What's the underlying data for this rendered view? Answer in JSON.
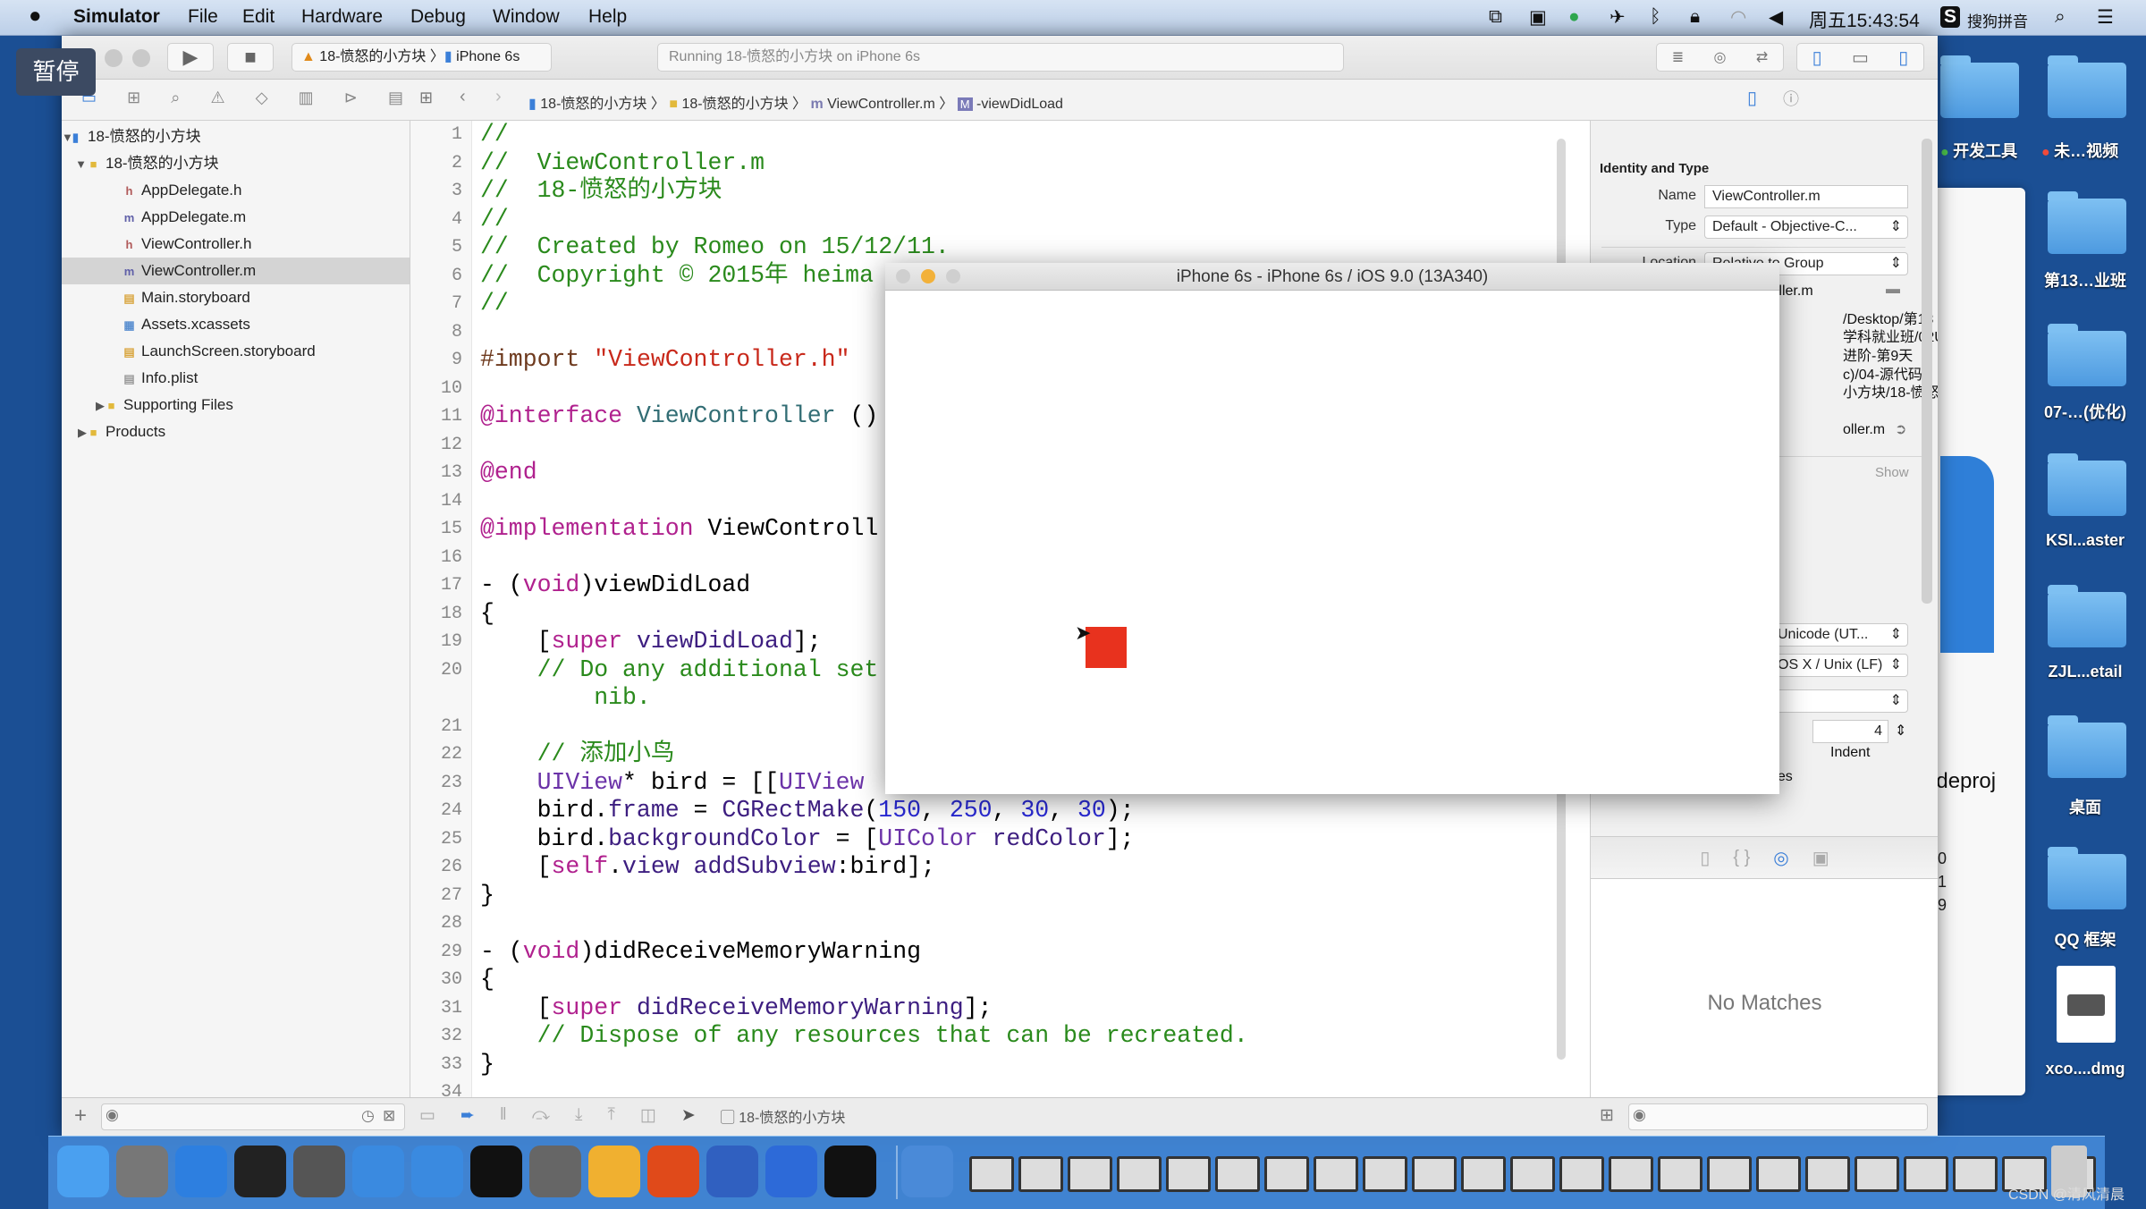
{
  "menubar": {
    "apple": "",
    "app": "Simulator",
    "items": [
      "File",
      "Edit",
      "Hardware",
      "Debug",
      "Window",
      "Help"
    ],
    "clock": "周五15:43:54",
    "ime": "搜狗拼音"
  },
  "pause_badge": "暂停",
  "toolbar": {
    "scheme": "18-愤怒的小方块",
    "device": "iPhone 6s",
    "activity": "Running 18-愤怒的小方块 on iPhone 6s"
  },
  "jumpbar": {
    "crumbs": [
      "18-愤怒的小方块",
      "18-愤怒的小方块",
      "ViewController.m",
      "-viewDidLoad"
    ]
  },
  "navigator": {
    "items": [
      {
        "label": "18-愤怒的小方块",
        "icon": "project-icon",
        "depth": 0,
        "disclosure": "▼"
      },
      {
        "label": "18-愤怒的小方块",
        "icon": "folder-icon",
        "depth": 1,
        "disclosure": "▼"
      },
      {
        "label": "AppDelegate.h",
        "icon": "h",
        "depth": 2
      },
      {
        "label": "AppDelegate.m",
        "icon": "m",
        "depth": 2
      },
      {
        "label": "ViewController.h",
        "icon": "h",
        "depth": 2
      },
      {
        "label": "ViewController.m",
        "icon": "m",
        "depth": 2,
        "selected": true
      },
      {
        "label": "Main.storyboard",
        "icon": "storyboard",
        "depth": 2
      },
      {
        "label": "Assets.xcassets",
        "icon": "assets",
        "depth": 2
      },
      {
        "label": "LaunchScreen.storyboard",
        "icon": "storyboard",
        "depth": 2
      },
      {
        "label": "Info.plist",
        "icon": "plist",
        "depth": 2
      },
      {
        "label": "Supporting Files",
        "icon": "folder-icon",
        "depth": 2,
        "disclosure": "▶"
      },
      {
        "label": "Products",
        "icon": "folder-icon",
        "depth": 1,
        "disclosure": "▶"
      }
    ]
  },
  "code": [
    {
      "n": "1",
      "t": [
        [
          "//",
          "c"
        ]
      ]
    },
    {
      "n": "2",
      "t": [
        [
          "//  ViewController.m",
          "c"
        ]
      ]
    },
    {
      "n": "3",
      "t": [
        [
          "//  18-愤怒的小方块",
          "c"
        ]
      ]
    },
    {
      "n": "4",
      "t": [
        [
          "//",
          "c"
        ]
      ]
    },
    {
      "n": "5",
      "t": [
        [
          "//  Created by Romeo on 15/12/11.",
          "c"
        ]
      ]
    },
    {
      "n": "6",
      "t": [
        [
          "//  Copyright © 2015年 heima",
          "c"
        ]
      ]
    },
    {
      "n": "7",
      "t": [
        [
          "//",
          "c"
        ]
      ]
    },
    {
      "n": "8",
      "t": []
    },
    {
      "n": "9",
      "t": [
        [
          "#import ",
          "pp"
        ],
        [
          "\"ViewController.h\"",
          "s"
        ]
      ]
    },
    {
      "n": "10",
      "t": []
    },
    {
      "n": "11",
      "t": [
        [
          "@interface ",
          "k"
        ],
        [
          "ViewController",
          "v"
        ],
        [
          " ()",
          ""
        ]
      ]
    },
    {
      "n": "12",
      "t": []
    },
    {
      "n": "13",
      "t": [
        [
          "@end",
          "k"
        ]
      ]
    },
    {
      "n": "14",
      "t": []
    },
    {
      "n": "15",
      "t": [
        [
          "@implementation ",
          "k"
        ],
        [
          "ViewControll",
          ""
        ]
      ]
    },
    {
      "n": "16",
      "t": []
    },
    {
      "n": "17",
      "t": [
        [
          "- (",
          ""
        ],
        [
          "void",
          "k"
        ],
        [
          ")viewDidLoad",
          ""
        ]
      ]
    },
    {
      "n": "18",
      "t": [
        [
          "{",
          ""
        ]
      ]
    },
    {
      "n": "19",
      "t": [
        [
          "    [",
          ""
        ],
        [
          "super",
          "k"
        ],
        [
          " ",
          ""
        ],
        [
          "viewDidLoad",
          "m"
        ],
        [
          "];",
          ""
        ]
      ]
    },
    {
      "n": "20",
      "t": [
        [
          "    // Do any additional set",
          "c"
        ]
      ],
      "wrap": "        nib."
    },
    {
      "n": "21",
      "t": []
    },
    {
      "n": "22",
      "t": [
        [
          "    // 添加小鸟",
          "c"
        ]
      ]
    },
    {
      "n": "23",
      "t": [
        [
          "    ",
          ""
        ],
        [
          "UIView",
          "t"
        ],
        [
          "* bird = [[",
          ""
        ],
        [
          "UIView",
          "t"
        ]
      ]
    },
    {
      "n": "24",
      "t": [
        [
          "    bird.",
          ""
        ],
        [
          "frame",
          "m"
        ],
        [
          " = ",
          ""
        ],
        [
          "CGRectMake",
          "m"
        ],
        [
          "(",
          ""
        ],
        [
          "150",
          "n"
        ],
        [
          ", ",
          ""
        ],
        [
          "250",
          "n"
        ],
        [
          ", ",
          ""
        ],
        [
          "30",
          "n"
        ],
        [
          ", ",
          ""
        ],
        [
          "30",
          "n"
        ],
        [
          ");",
          ""
        ]
      ]
    },
    {
      "n": "25",
      "t": [
        [
          "    bird.",
          ""
        ],
        [
          "backgroundColor",
          "m"
        ],
        [
          " = [",
          ""
        ],
        [
          "UIColor",
          "t"
        ],
        [
          " ",
          ""
        ],
        [
          "redColor",
          "m"
        ],
        [
          "];",
          ""
        ]
      ]
    },
    {
      "n": "26",
      "t": [
        [
          "    [",
          ""
        ],
        [
          "self",
          "k"
        ],
        [
          ".",
          ""
        ],
        [
          "view",
          "m"
        ],
        [
          " ",
          ""
        ],
        [
          "addSubview",
          "m"
        ],
        [
          ":bird];",
          ""
        ]
      ]
    },
    {
      "n": "27",
      "t": [
        [
          "}",
          ""
        ]
      ]
    },
    {
      "n": "28",
      "t": []
    },
    {
      "n": "29",
      "t": [
        [
          "- (",
          ""
        ],
        [
          "void",
          "k"
        ],
        [
          ")didReceiveMemoryWarning",
          ""
        ]
      ]
    },
    {
      "n": "30",
      "t": [
        [
          "{",
          ""
        ]
      ]
    },
    {
      "n": "31",
      "t": [
        [
          "    [",
          ""
        ],
        [
          "super",
          "k"
        ],
        [
          " ",
          ""
        ],
        [
          "didReceiveMemoryWarning",
          "m"
        ],
        [
          "];",
          ""
        ]
      ]
    },
    {
      "n": "32",
      "t": [
        [
          "    // Dispose of any resources that can be recreated.",
          "c"
        ]
      ]
    },
    {
      "n": "33",
      "t": [
        [
          "}",
          ""
        ]
      ]
    },
    {
      "n": "34",
      "t": []
    }
  ],
  "inspector": {
    "section": "Identity and Type",
    "name_label": "Name",
    "name_value": "ViewController.m",
    "type_label": "Type",
    "type_value": "Default - Objective-C...",
    "location_label": "Location",
    "location_value": "Relative to Group",
    "file_name": "ViewController.m",
    "path_fragments": [
      "/Desktop/第13",
      "学科就业班/02UI",
      "进阶-第9天",
      "c)/04-源代码/",
      "小方块/18-愤怒"
    ],
    "full_path_fragment": "oller.m",
    "show": "Show",
    "encoding": "Unicode (UT...",
    "line_endings": "OS X / Unix (LF)",
    "indent_value": "4",
    "indent_label": "Indent",
    "lines_fragment": "nes",
    "no_matches": "No Matches"
  },
  "bottombar": {
    "target": "18-愤怒的小方块"
  },
  "simulator": {
    "title": "iPhone 6s - iPhone 6s / iOS 9.0 (13A340)",
    "bird_color": "#e8321e"
  },
  "finder_fragments": {
    "name": "odeproj",
    "times": [
      ":50",
      ":31",
      ":39"
    ]
  },
  "desktop": {
    "tags": [
      {
        "label": "开发工具",
        "color": "#4cc24c"
      },
      {
        "label": "未…视频",
        "color": "#f04a3a"
      }
    ],
    "icons": [
      "第13…业班",
      "07-…(优化)",
      "KSI...aster",
      "ZJL...etail",
      "桌面",
      "QQ 框架"
    ],
    "dmg": "xco....dmg",
    "copy": "copy"
  },
  "dock": {
    "apps": [
      "Finder",
      "Launchpad",
      "Safari",
      "Mouse",
      "Photo Booth",
      "Xcode",
      "Simulator",
      "Terminal",
      "System Preferences",
      "Sketch",
      "PP",
      "QuickTime",
      "TeamViewer",
      "Console",
      "Photos"
    ]
  },
  "watermark": "CSDN @清风清晨"
}
